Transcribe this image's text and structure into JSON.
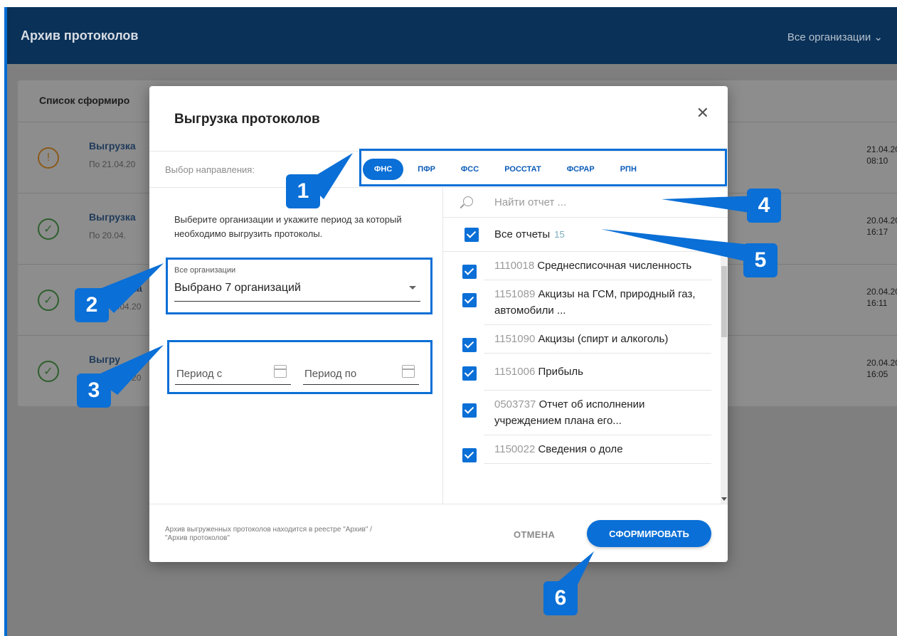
{
  "app": {
    "title": "Архив протоколов",
    "org_selector": "Все организации ⌄"
  },
  "list": {
    "heading": "Список сформиро",
    "rows": [
      {
        "title": "Выгрузка",
        "sub": "По 21.04.20",
        "date": "21.04.20",
        "time": "08:10",
        "status": "warning"
      },
      {
        "title": "Выгрузка",
        "sub": "По 20.04.",
        "date": "20.04.20",
        "time": "16:17",
        "status": "ok"
      },
      {
        "title": "ка",
        "sub": ".04.20",
        "date": "20.04.20",
        "time": "16:11",
        "status": "ok"
      },
      {
        "title": "Выгру",
        "sub": ".04.20",
        "date": "20.04.20",
        "time": "16:05",
        "status": "ok"
      }
    ]
  },
  "modal": {
    "title": "Выгрузка протоколов",
    "direction_label": "Выбор направления:",
    "tabs": [
      "ФНС",
      "ПФР",
      "ФСС",
      "РОССТАТ",
      "ФСРАР",
      "РПН"
    ],
    "active_tab": "ФНС",
    "info": "Выберите организации и укажите период за который необходимо выгрузить протоколы.",
    "org_field_label": "Все организации",
    "org_field_value": "Выбрано 7 организаций",
    "period_from": "Период с",
    "period_to": "Период по",
    "search_placeholder": "Найти отчет ...",
    "all_reports_label": "Все отчеты",
    "all_reports_count": "15",
    "reports": [
      {
        "code": "1110018",
        "name": "Среднесписочная численность"
      },
      {
        "code": "1151089",
        "name": "Акцизы на ГСМ, природный газ, автомобили ..."
      },
      {
        "code": "1151090",
        "name": "Акцизы (спирт и алкоголь)"
      },
      {
        "code": "1151006",
        "name": "Прибыль"
      },
      {
        "code": "0503737",
        "name": "Отчет об исполнении учреждением плана его..."
      },
      {
        "code": "1150022",
        "name": "Сведения о доле"
      }
    ],
    "footer_note": "Архив выгруженных протоколов находится в реестре \"Архив\" / \"Архив протоколов\"",
    "cancel": "ОТМЕНА",
    "submit": "СФОРМИРОВАТЬ"
  },
  "callouts": [
    "1",
    "2",
    "3",
    "4",
    "5",
    "6"
  ],
  "colors": {
    "accent": "#0a6fd6",
    "topbar": "#0a3158"
  }
}
